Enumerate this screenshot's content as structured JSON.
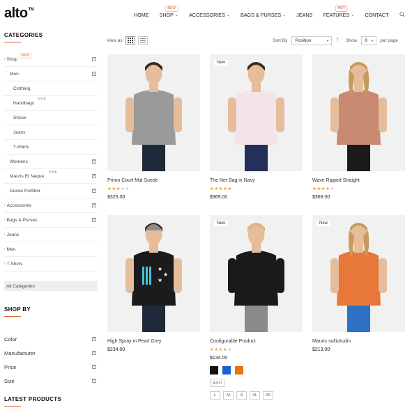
{
  "brand": {
    "logo_text": "alto",
    "tm": "TM"
  },
  "nav": [
    {
      "label": "HOME",
      "caret": false
    },
    {
      "label": "SHOP",
      "caret": true,
      "badge": "NEW"
    },
    {
      "label": "ACCESSORIES",
      "caret": true
    },
    {
      "label": "BAGS & PURSES",
      "caret": true
    },
    {
      "label": "JEANS",
      "caret": false
    },
    {
      "label": "FEATURES",
      "caret": true,
      "badge": "HOT"
    },
    {
      "label": "CONTACT",
      "caret": false
    }
  ],
  "sidebar": {
    "categories_heading": "CATEGORIES",
    "categories": [
      {
        "label": "Shop",
        "badge": "NEW",
        "toggle": "−"
      },
      {
        "label": "Men",
        "toggle": "−"
      },
      {
        "label": "Clothing"
      },
      {
        "label": "Handbags",
        "badge": "SALE"
      },
      {
        "label": "Shose"
      },
      {
        "label": "Jeans"
      },
      {
        "label": "T-Shirts"
      },
      {
        "label": "Womens",
        "toggle": "+"
      },
      {
        "label": "Mauris Et Neque",
        "badge": "SALE",
        "toggle": "+"
      },
      {
        "label": "Donec Porttitor",
        "toggle": "+"
      },
      {
        "label": "Accessories",
        "toggle": "+"
      },
      {
        "label": "Bags & Purses",
        "toggle": "+"
      },
      {
        "label": "Jeans"
      },
      {
        "label": "Men"
      },
      {
        "label": "T-Shirts"
      }
    ],
    "all_categories": "All Categories",
    "shop_by_heading": "SHOP BY",
    "filters": [
      {
        "label": "Color",
        "toggle": "+"
      },
      {
        "label": "Manufacturer",
        "toggle": "+"
      },
      {
        "label": "Price",
        "toggle": "+"
      },
      {
        "label": "Size",
        "toggle": "+"
      }
    ],
    "latest_heading": "LATEST PRODUCTS"
  },
  "toolbar": {
    "view_as": "View as",
    "sort_by": "Sort By",
    "sort_value": "Position",
    "show": "Show",
    "show_value": "9",
    "per_page": "per page"
  },
  "products": [
    {
      "name": "Primo Court Mid Suede",
      "price": "$325.00",
      "rating": 3,
      "is_new": false,
      "shirt_color": "#9a9a9a"
    },
    {
      "name": "The Net Bag in Navy",
      "price": "$369.00",
      "rating": 5,
      "is_new": true,
      "new_label": "New",
      "shirt_color": "#f3e4ea"
    },
    {
      "name": "Wave Ripped Straight",
      "price": "$369.00",
      "rating": 4,
      "is_new": false,
      "shirt_color": "#c98a74"
    },
    {
      "name": "High Spray in Pearl Grey",
      "price": "$234.00",
      "rating": null,
      "is_new": false,
      "shirt_color": "#1b1b1b"
    },
    {
      "name": "Configurable Product",
      "price": "$134.00",
      "rating": 4,
      "is_new": true,
      "new_label": "New",
      "shirt_color": "#1a1a1a"
    },
    {
      "name": "Mauris sollicitudin",
      "price": "$213.00",
      "rating": null,
      "is_new": true,
      "new_label": "New",
      "shirt_color": "#e8783a"
    }
  ],
  "configurable": {
    "swatch_colors": [
      "#111111",
      "#1e5ed8",
      "#e8730f"
    ],
    "tag": "gucci",
    "sizes": [
      "L",
      "M",
      "S",
      "XL",
      "XS"
    ]
  }
}
